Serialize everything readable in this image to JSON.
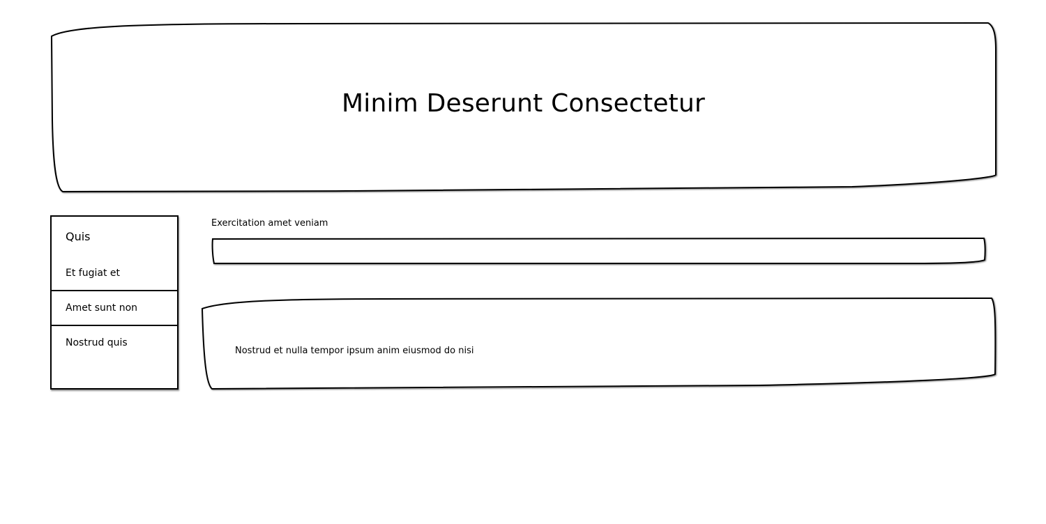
{
  "header": {
    "title": "Minim Deserunt Consectetur"
  },
  "sidebar": {
    "heading": "Quis",
    "items": [
      {
        "label": "Et fugiat et"
      },
      {
        "label": "Amet sunt non"
      },
      {
        "label": "Nostrud quis"
      }
    ]
  },
  "form": {
    "label": "Exercitation amet veniam",
    "input_value": "",
    "input_placeholder": ""
  },
  "content": {
    "paragraph": "Nostrud et nulla tempor ipsum anim eiusmod do nisi"
  }
}
